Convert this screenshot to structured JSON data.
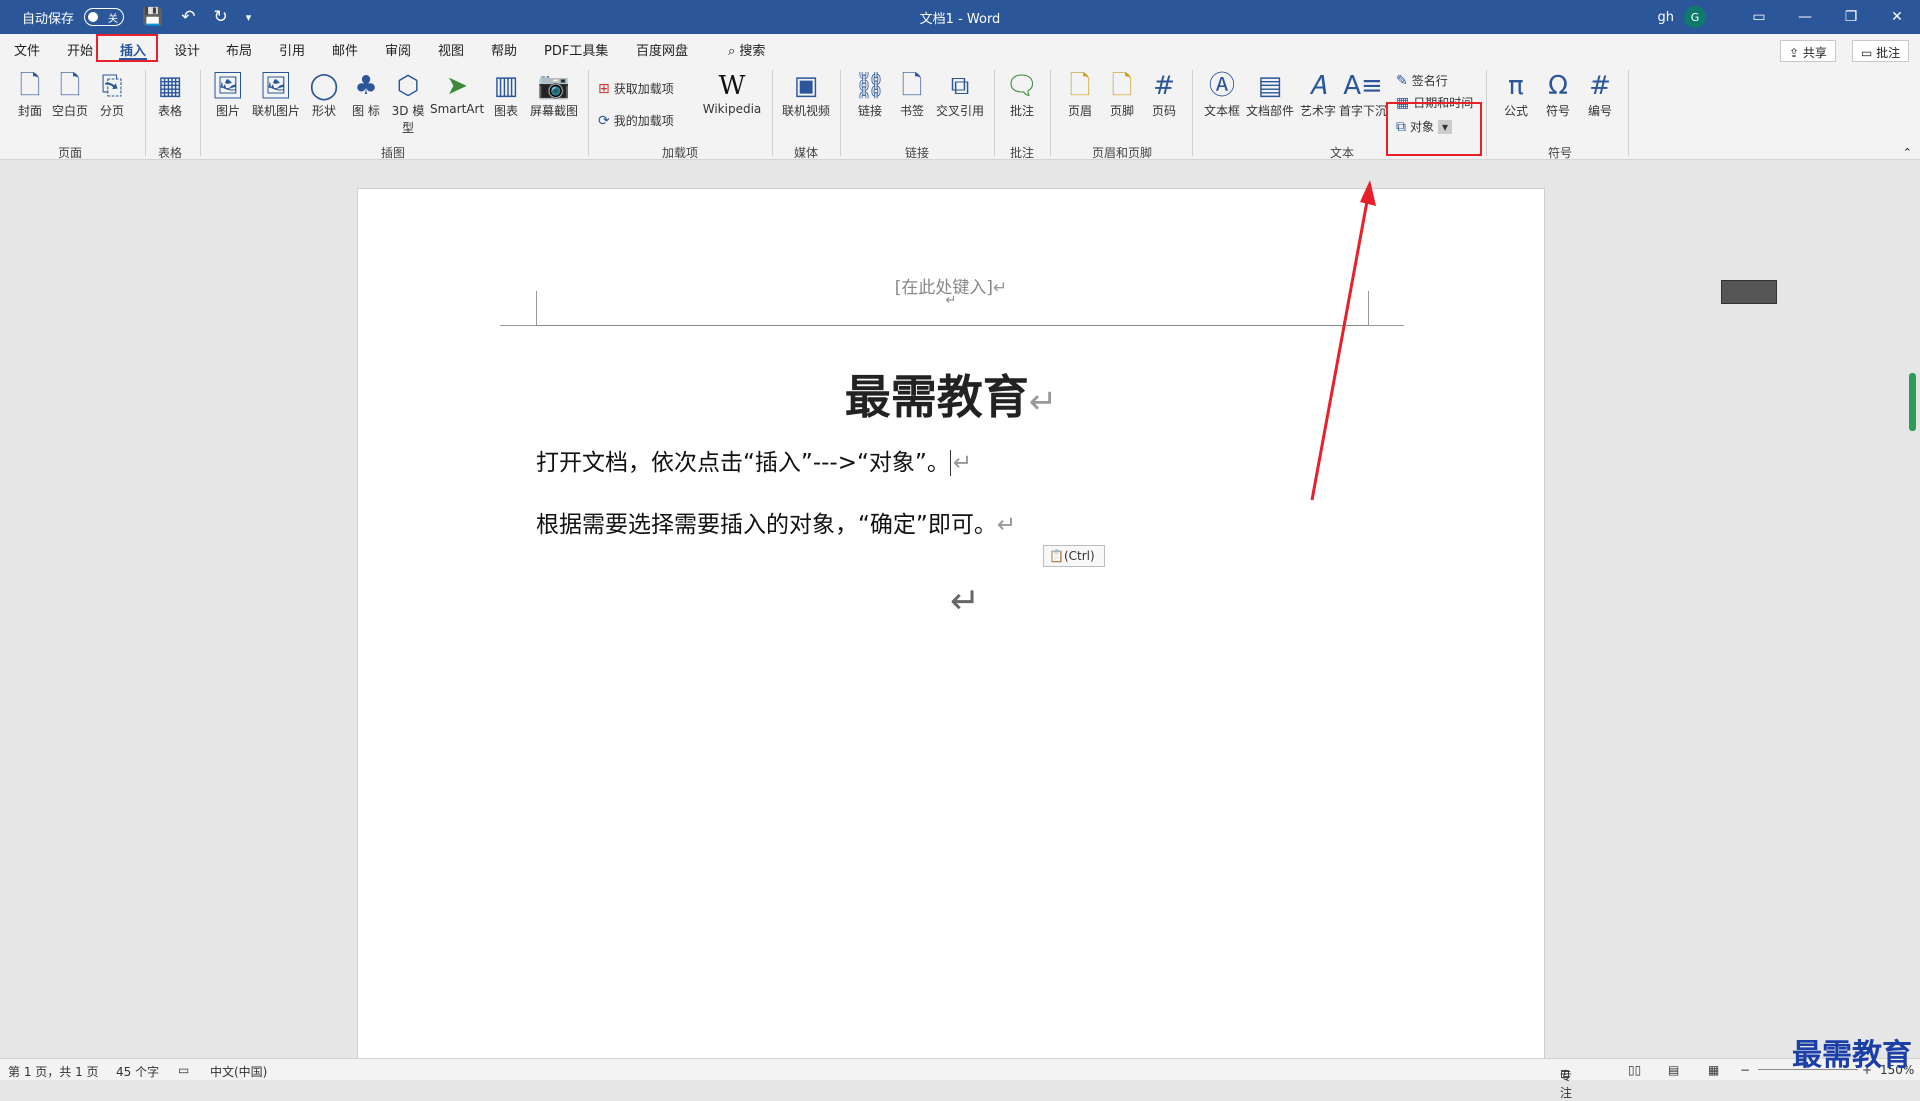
{
  "titlebar": {
    "autosave_label": "自动保存",
    "autosave_state": "关",
    "doc_title": "文档1 - Word",
    "user": "gh",
    "avatar_initial": "G",
    "minimize": "—",
    "restore": "❐",
    "close": "✕"
  },
  "tabs": [
    "文件",
    "开始",
    "插入",
    "设计",
    "布局",
    "引用",
    "邮件",
    "审阅",
    "视图",
    "帮助",
    "PDF工具集",
    "百度网盘"
  ],
  "search": "搜索",
  "share_label": "共享",
  "comments_label": "批注",
  "groups": {
    "page": "页面",
    "table": "表格",
    "illustrations": "插图",
    "addins": "加载项",
    "media": "媒体",
    "links": "链接",
    "comments": "批注",
    "header_footer": "页眉和页脚",
    "text": "文本",
    "symbols": "符号"
  },
  "buttons": {
    "cover": "封面",
    "blank": "空白页",
    "break": "分页",
    "table": "表格",
    "picture": "图片",
    "online_picture": "联机图片",
    "shapes": "形状",
    "icons": "图\n标",
    "model3d": "3D\n模型",
    "smartart": "SmartArt",
    "chart": "图表",
    "screenshot": "屏幕截图",
    "get_addins": "获取加载项",
    "my_addins": "我的加载项",
    "wikipedia": "Wikipedia",
    "online_video": "联机视频",
    "link": "链接",
    "bookmark": "书签",
    "cross_ref": "交叉引用",
    "comment": "批注",
    "header": "页眉",
    "footer": "页脚",
    "page_number": "页码",
    "textbox": "文本框",
    "quick_parts": "文档部件",
    "wordart": "艺术字",
    "dropcap": "首字下沉",
    "signature_line": "签名行",
    "date_time": "日期和时间",
    "object": "对象",
    "equation": "公式",
    "symbol": "符号",
    "number": "编号"
  },
  "document": {
    "header_placeholder": "[在此处键入]",
    "title": "最需教育",
    "para1": "打开文档，依次点击“插入”--->“对象”。",
    "para2": "根据需要选择需要插入的对象，“确定”即可。",
    "paste_chip": "(Ctrl)",
    "return_mark": "↵"
  },
  "status": {
    "page": "第 1 页，共 1 页",
    "words": "45 个字",
    "language": "中文(中国)",
    "focus": "专注",
    "zoom": "150%"
  },
  "watermark": "最需教育"
}
